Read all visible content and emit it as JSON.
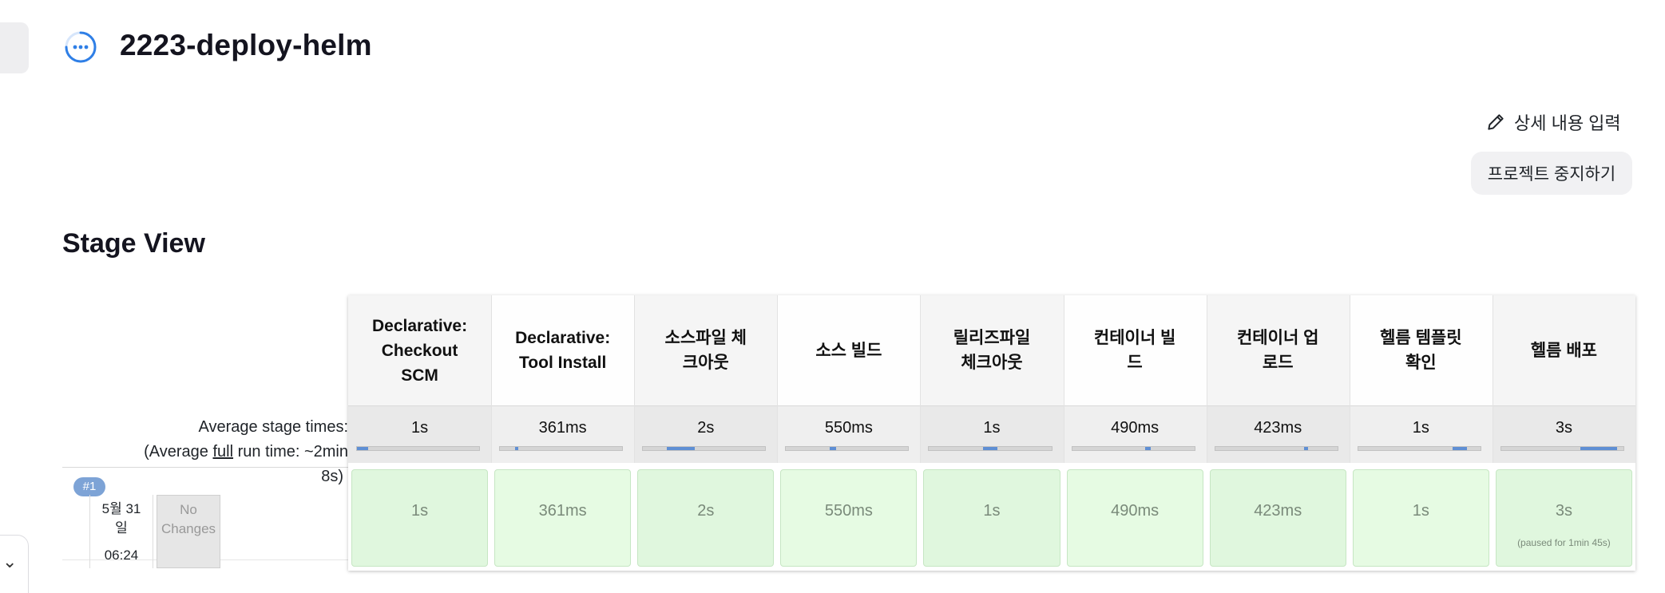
{
  "page": {
    "title": "2223-deploy-helm"
  },
  "actions": {
    "edit_description": "상세 내용 입력",
    "disable_project": "프로젝트 중지하기"
  },
  "stage_view": {
    "title": "Stage View",
    "avg_label_line1": "Average stage times:",
    "avg_label_line2_pre": "(Average ",
    "avg_label_line2_link": "full",
    "avg_label_line2_post": " run time: ~2min",
    "avg_label_line3": "8s)",
    "run": {
      "badge": "#1",
      "date_line1": "5월 31",
      "date_line2": "일",
      "time": "06:24",
      "changes_line1": "No",
      "changes_line2": "Changes"
    },
    "stages": [
      {
        "name_lines": [
          "Declarative:",
          "Checkout",
          "SCM"
        ],
        "avg": "1s",
        "bar_fill": 0.09,
        "cell": "1s",
        "note": ""
      },
      {
        "name_lines": [
          "Declarative:",
          "Tool Install"
        ],
        "avg": "361ms",
        "bar_fill": 0.03,
        "cell": "361ms",
        "note": ""
      },
      {
        "name_lines": [
          "소스파일 체",
          "크아웃"
        ],
        "avg": "2s",
        "bar_fill": 0.23,
        "cell": "2s",
        "note": ""
      },
      {
        "name_lines": [
          "소스 빌드"
        ],
        "avg": "550ms",
        "bar_fill": 0.05,
        "cell": "550ms",
        "note": ""
      },
      {
        "name_lines": [
          "릴리즈파일",
          "체크아웃"
        ],
        "avg": "1s",
        "bar_fill": 0.12,
        "cell": "1s",
        "note": ""
      },
      {
        "name_lines": [
          "컨테이너 빌",
          "드"
        ],
        "avg": "490ms",
        "bar_fill": 0.04,
        "cell": "490ms",
        "note": ""
      },
      {
        "name_lines": [
          "컨테이너 업",
          "로드"
        ],
        "avg": "423ms",
        "bar_fill": 0.03,
        "cell": "423ms",
        "note": ""
      },
      {
        "name_lines": [
          "헬름 템플릿",
          "확인"
        ],
        "avg": "1s",
        "bar_fill": 0.12,
        "cell": "1s",
        "note": ""
      },
      {
        "name_lines": [
          "헬름 배포"
        ],
        "avg": "3s",
        "bar_fill": 0.3,
        "cell": "3s",
        "note": "(paused for 1min 45s)"
      }
    ]
  },
  "colors": {
    "status_icon": "#2f7fe6",
    "success_cell": "#e0f7de",
    "bar_fill": "#5f8fd4",
    "run_badge": "#7da3d6"
  }
}
